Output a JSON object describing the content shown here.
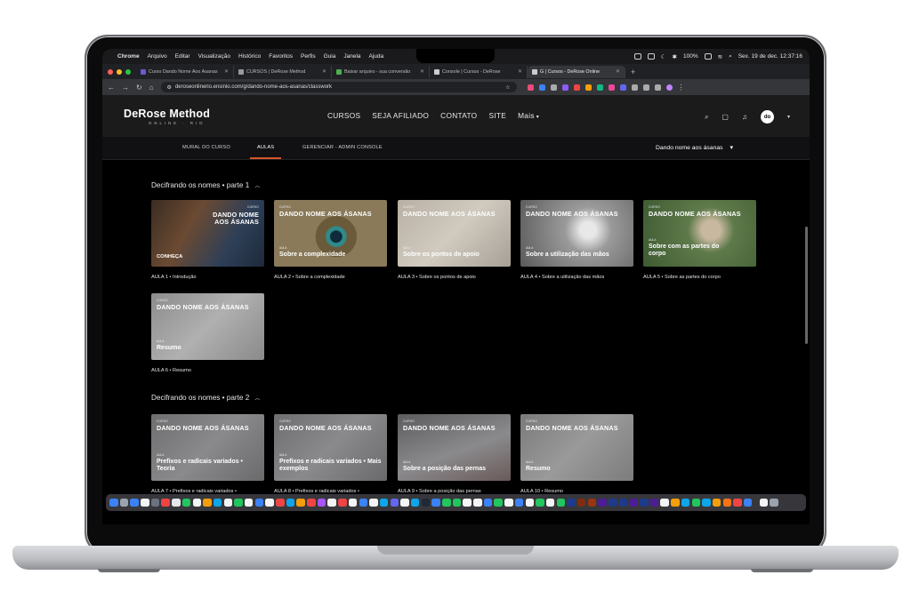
{
  "menubar": {
    "app": "Chrome",
    "menus": [
      "Arquivo",
      "Editar",
      "Visualização",
      "Histórico",
      "Favoritos",
      "Perfis",
      "Guia",
      "Janela",
      "Ajuda"
    ],
    "battery": "100%",
    "datetime": "Sex. 19 de dec.  12:37:16"
  },
  "tabs": [
    {
      "label": "Curso Dando Nome Aos Ásanas",
      "color": "#6a5acd"
    },
    {
      "label": "CURSOS | DeRose Method",
      "color": "#999999"
    },
    {
      "label": "Baixar arquivo - sua conversão",
      "color": "#4caf50"
    },
    {
      "label": "Console | Cursos - DeRose",
      "color": "#cccccc"
    },
    {
      "label": "G | Cursos - DeRose Online",
      "color": "#cccccc"
    }
  ],
  "address": {
    "url": "deroseonlinerio.ensinio.com/g/dando-nome-aos-asanas/classwork"
  },
  "site": {
    "logo_main": "DeRose Method",
    "logo_sub": "ONLINE · RIO",
    "nav": [
      "CURSOS",
      "SEJA AFILIADO",
      "CONTATO",
      "SITE"
    ],
    "nav_more": "Mais",
    "avatar": "do"
  },
  "subnav": {
    "tabs": [
      "MURAL DO CURSO",
      "AULAS",
      "GERENCIAR - ADMIN CONSOLE"
    ],
    "active": "AULAS",
    "course": "Dando nome aos ásanas"
  },
  "sections": [
    {
      "title": "Decifrando os nomes • parte 1",
      "lessons": [
        {
          "kicker": "CURSO",
          "title": "DANDO NOME AOS ÁSANAS",
          "label": "",
          "sub": "CONHEÇA",
          "caption": "AULA 1 • Introdução"
        },
        {
          "kicker": "CURSO",
          "title": "DANDO NOME AOS ÁSANAS",
          "label": "AULA",
          "sub": "Sobre a complexidade",
          "caption": "AULA 2 • Sobre a complexidade"
        },
        {
          "kicker": "CURSO",
          "title": "DANDO NOME AOS ÁSANAS",
          "label": "AULA",
          "sub": "Sobre os pontos de apoio",
          "caption": "AULA 3 • Sobre os pontos de apoio"
        },
        {
          "kicker": "CURSO",
          "title": "DANDO NOME AOS ÁSANAS",
          "label": "AULA",
          "sub": "Sobre a utilização das mãos",
          "caption": "AULA 4 • Sobre a utilização das mãos"
        },
        {
          "kicker": "CURSO",
          "title": "DANDO NOME AOS ÁSANAS",
          "label": "AULA",
          "sub": "Sobre com as partes do corpo",
          "caption": "AULA 5 • Sobre as partes do corpo"
        },
        {
          "kicker": "CURSO",
          "title": "DANDO NOME AOS ÁSANAS",
          "label": "AULA",
          "sub": "Resumo",
          "caption": "AULA 6 • Resumo"
        }
      ]
    },
    {
      "title": "Decifrando os nomes • parte 2",
      "lessons": [
        {
          "kicker": "CURSO",
          "title": "DANDO NOME AOS ÁSANAS",
          "label": "AULA",
          "sub": "Prefixos e radicais variados • Teoria",
          "caption": "AULA 7 • Prefixos e radicais variados •"
        },
        {
          "kicker": "CURSO",
          "title": "DANDO NOME AOS ÁSANAS",
          "label": "AULA",
          "sub": "Prefixos e radicais variados • Mais exemplos",
          "caption": "AULA 8 • Prefixos e radicais variados •"
        },
        {
          "kicker": "CURSO",
          "title": "DANDO NOME AOS ÁSANAS",
          "label": "AULA",
          "sub": "Sobre a posição das pernas",
          "caption": "AULA 9 • Sobre a posição das pernas"
        },
        {
          "kicker": "CURSO",
          "title": "DANDO NOME AOS ÁSANAS",
          "label": "AULA",
          "sub": "Resumo",
          "caption": "AULA 10 • Resumo"
        }
      ]
    }
  ],
  "colors": {
    "accent": "#d7552b",
    "header": "#1b1b1c",
    "background": "#000000"
  }
}
